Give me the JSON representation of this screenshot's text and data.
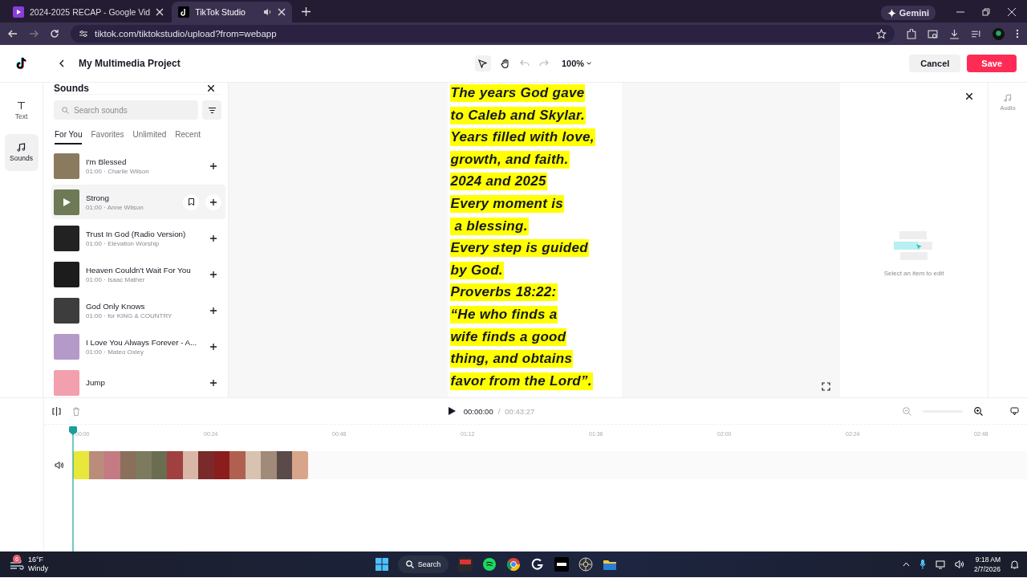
{
  "browser": {
    "tabs": [
      {
        "title": "2024-2025 RECAP - Google Vid",
        "selected": false
      },
      {
        "title": "TikTok Studio",
        "selected": true
      }
    ],
    "gemini": "Gemini",
    "url": "tiktok.com/tiktokstudio/upload?from=webapp"
  },
  "header": {
    "title": "My Multimedia Project",
    "zoom": "100%",
    "cancel": "Cancel",
    "save": "Save"
  },
  "left_rail": [
    {
      "label": "Text",
      "selected": false
    },
    {
      "label": "Sounds",
      "selected": true
    }
  ],
  "sounds": {
    "title": "Sounds",
    "search": {
      "placeholder": "Search sounds"
    },
    "tabs": [
      {
        "label": "For You",
        "selected": true
      },
      {
        "label": "Favorites",
        "selected": false
      },
      {
        "label": "Unlimited",
        "selected": false
      },
      {
        "label": "Recent",
        "selected": false
      }
    ],
    "items": [
      {
        "title": "I'm Blessed",
        "subtitle": "01:00 · Charlie Wilson",
        "hovered": false
      },
      {
        "title": "Strong",
        "subtitle": "01:00 · Anne Wilson",
        "hovered": true
      },
      {
        "title": "Trust In God (Radio Version)",
        "subtitle": "01:00 · Elevation Worship",
        "hovered": false
      },
      {
        "title": "Heaven Couldn't Wait For You",
        "subtitle": "01:00 · Isaac Mather",
        "hovered": false
      },
      {
        "title": "God Only Knows",
        "subtitle": "01:00 · for KING & COUNTRY",
        "hovered": false
      },
      {
        "title": "I Love You Always Forever - A...",
        "subtitle": "01:00 · Mateo Oxley",
        "hovered": false
      },
      {
        "title": "Jump",
        "hovered": false
      }
    ]
  },
  "preview": {
    "lines": [
      "The years God gave",
      "to Caleb and Skylar.",
      "Years filled with love,",
      "growth, and faith.",
      "2024 and 2025",
      "Every moment is",
      " a blessing.",
      "Every step is guided",
      "by God.",
      "Proverbs 18:22:",
      "“He who finds a",
      "wife finds a good",
      "thing, and obtains",
      "favor from the Lord”."
    ]
  },
  "properties": {
    "empty_text": "Select an item to edit"
  },
  "right_rail": [
    {
      "label": "Audio"
    }
  ],
  "timeline": {
    "zoom_slider": {
      "level": 0
    },
    "current": "00:00:00",
    "separator": "/",
    "total": "00:43:27",
    "ticks": [
      "00:00",
      "00:24",
      "00:48",
      "01:12",
      "01:36",
      "02:00",
      "02:24",
      "02:48"
    ]
  },
  "taskbar": {
    "temperature": "16°F",
    "condition": "Windy",
    "badge": "6",
    "search": "Search",
    "time": "9:18 AM",
    "date": "2/7/2026"
  }
}
